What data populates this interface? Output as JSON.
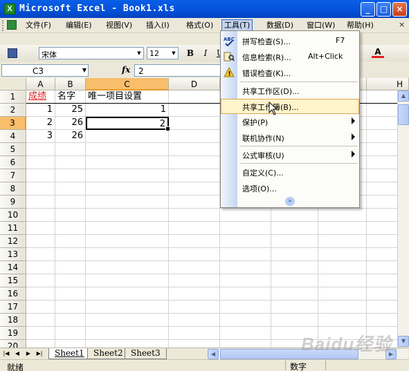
{
  "window": {
    "title": "Microsoft Excel - Book1.xls",
    "minimize": "_",
    "maximize": "□",
    "close": "×"
  },
  "menubar": {
    "items": [
      "文件(F)",
      "编辑(E)",
      "视图(V)",
      "插入(I)",
      "格式(O)",
      "工具(T)",
      "数据(D)",
      "窗口(W)",
      "帮助(H)"
    ],
    "active_index": 5,
    "doc_close": "×"
  },
  "toolbar": {
    "font_name": "宋体",
    "font_size": "12",
    "bold": "B",
    "italic": "I",
    "underline": "U",
    "font_color": "A"
  },
  "formula_bar": {
    "name_box": "C3",
    "fx": "fx",
    "value": "2"
  },
  "grid": {
    "columns": [
      "A",
      "B",
      "C",
      "D",
      "H"
    ],
    "selected_column": "C",
    "rows": [
      "1",
      "2",
      "3",
      "4",
      "5",
      "6",
      "7",
      "8",
      "9",
      "10",
      "11",
      "12",
      "13",
      "14",
      "15",
      "16",
      "17",
      "18",
      "19",
      "20"
    ],
    "selected_row": "3",
    "active_cell": "C3",
    "cells": {
      "A1": "成绩",
      "B1": "名字",
      "C1": "唯一项目设置",
      "A2": "1",
      "B2": "25",
      "C2": "1",
      "A3": "2",
      "B3": "26",
      "C3": "2",
      "A4": "3",
      "B4": "26"
    }
  },
  "tools_menu": {
    "items": [
      {
        "label": "拼写检查(S)...",
        "shortcut": "F7",
        "icon": "spell-check-icon"
      },
      {
        "label": "信息检索(R)...",
        "shortcut": "Alt+Click",
        "icon": "research-icon"
      },
      {
        "label": "错误检查(K)...",
        "shortcut": "",
        "icon": "error-check-icon"
      },
      {
        "label": "共享工作区(D)...",
        "shortcut": ""
      },
      {
        "label": "共享工作簿(B)...",
        "shortcut": "",
        "highlighted": true
      },
      {
        "label": "保护(P)",
        "submenu": true
      },
      {
        "label": "联机协作(N)",
        "submenu": true
      },
      {
        "label": "公式审核(U)",
        "submenu": true
      },
      {
        "label": "自定义(C)...",
        "shortcut": ""
      },
      {
        "label": "选项(O)...",
        "shortcut": ""
      }
    ],
    "expand": "»"
  },
  "sheets": {
    "tabs": [
      "Sheet1",
      "Sheet2",
      "Sheet3"
    ],
    "active": "Sheet1"
  },
  "status": {
    "ready": "就绪",
    "num": "数字"
  },
  "watermark": "Baidu经验",
  "colors": {
    "title_blue": "#0451d8",
    "selected_header": "#f8be6c",
    "menu_highlight": "#fff4cc",
    "red_text": "#e02020"
  }
}
